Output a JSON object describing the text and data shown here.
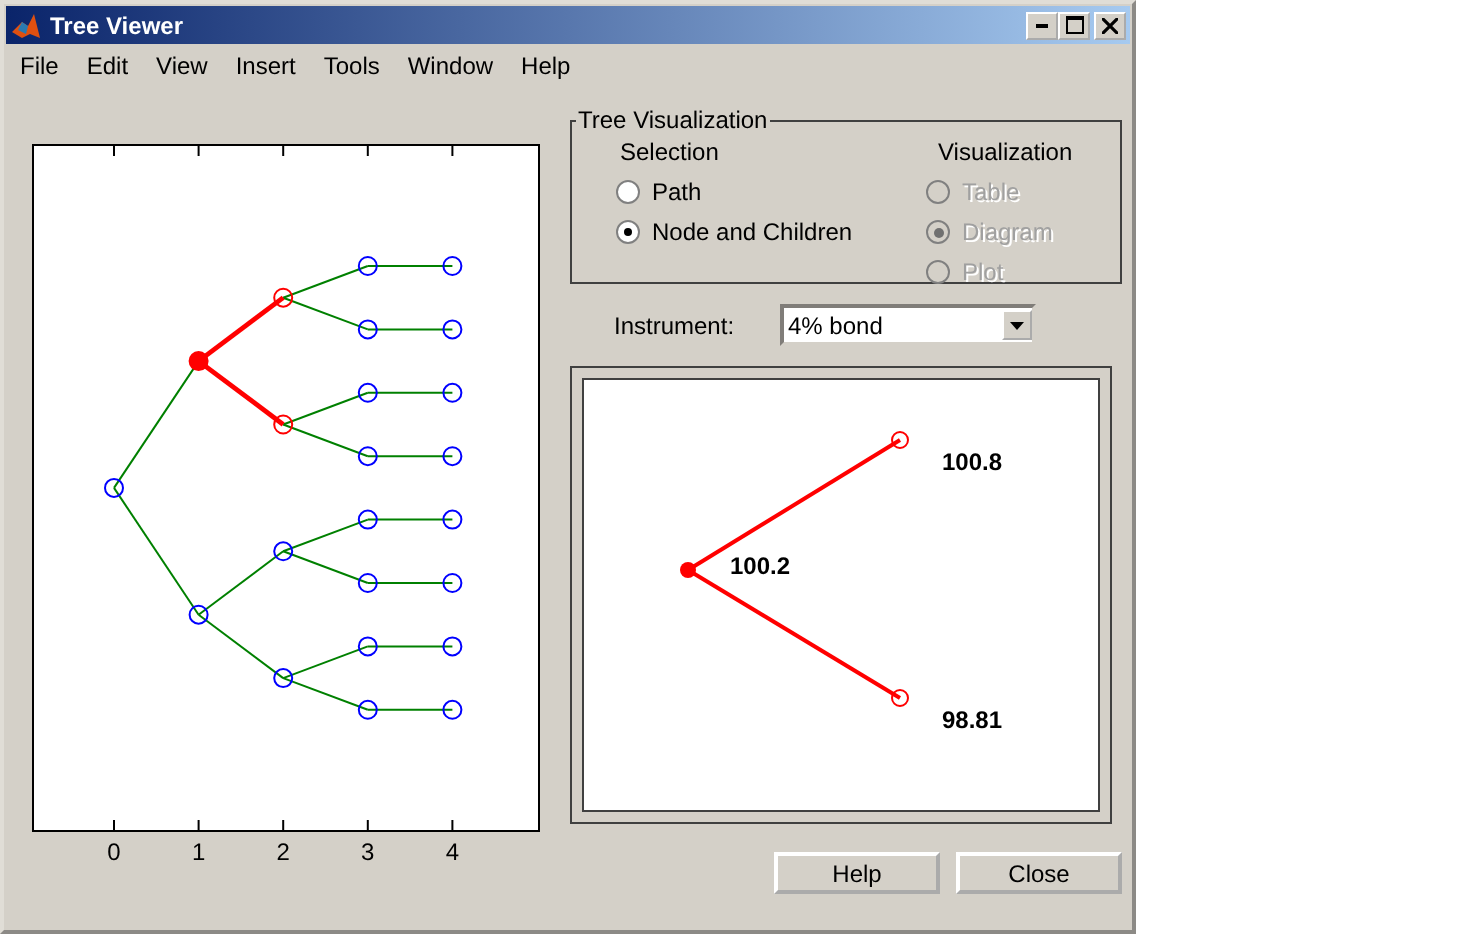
{
  "window": {
    "title": "Tree Viewer"
  },
  "menu": [
    "File",
    "Edit",
    "View",
    "Insert",
    "Tools",
    "Window",
    "Help"
  ],
  "tree_plot": {
    "xticks": [
      "0",
      "1",
      "2",
      "3",
      "4"
    ],
    "root": {
      "selected": false,
      "children": [
        {
          "selected": true,
          "children": [
            {
              "selected": false,
              "children": [
                {
                  "selected": false,
                  "children": [
                    {
                      "selected": false
                    }
                  ]
                },
                {
                  "selected": false,
                  "children": [
                    {
                      "selected": false
                    }
                  ]
                }
              ]
            },
            {
              "selected": false,
              "children": [
                {
                  "selected": false,
                  "children": [
                    {
                      "selected": false
                    }
                  ]
                },
                {
                  "selected": false,
                  "children": [
                    {
                      "selected": false
                    }
                  ]
                }
              ]
            }
          ]
        },
        {
          "selected": false,
          "children": [
            {
              "selected": false,
              "children": [
                {
                  "selected": false,
                  "children": [
                    {
                      "selected": false
                    }
                  ]
                },
                {
                  "selected": false,
                  "children": [
                    {
                      "selected": false
                    }
                  ]
                }
              ]
            },
            {
              "selected": false,
              "children": [
                {
                  "selected": false,
                  "children": [
                    {
                      "selected": false
                    }
                  ]
                },
                {
                  "selected": false,
                  "children": [
                    {
                      "selected": false
                    }
                  ]
                }
              ]
            }
          ]
        }
      ]
    }
  },
  "tree_visualization": {
    "title": "Tree Visualization",
    "selection": {
      "label": "Selection",
      "options": [
        {
          "label": "Path",
          "selected": false,
          "disabled": false
        },
        {
          "label": "Node and Children",
          "selected": true,
          "disabled": false
        }
      ]
    },
    "visualization": {
      "label": "Visualization",
      "options": [
        {
          "label": "Table",
          "selected": false,
          "disabled": true
        },
        {
          "label": "Diagram",
          "selected": true,
          "disabled": true
        },
        {
          "label": "Plot",
          "selected": false,
          "disabled": true
        }
      ]
    }
  },
  "instrument": {
    "label": "Instrument:",
    "value": "4% bond"
  },
  "node_detail": {
    "value": "100.2",
    "children": [
      {
        "value": "100.8"
      },
      {
        "value": "98.81"
      }
    ]
  },
  "buttons": [
    "Help",
    "Close"
  ]
}
